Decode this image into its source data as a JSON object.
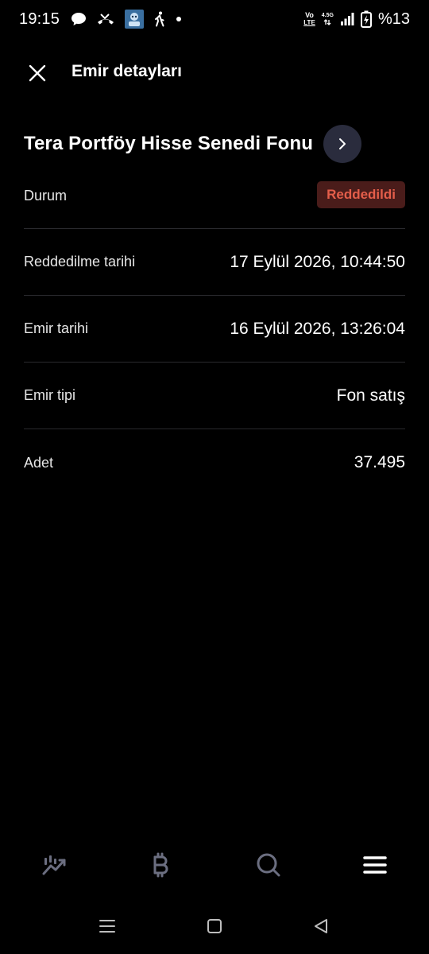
{
  "status_bar": {
    "time": "19:15",
    "left_icons": [
      "chat-bubble-icon",
      "missed-call-icon",
      "app-avatar-icon",
      "walking-icon",
      "dot-icon"
    ],
    "network_top": "Vo",
    "network_bottom": "LTE",
    "network_gen": "4.5G",
    "battery_text": "%13"
  },
  "header": {
    "title": "Emir detayları"
  },
  "fund": {
    "name": "Tera Portföy Hisse Senedi Fonu"
  },
  "details": {
    "status": {
      "label": "Durum",
      "value": "Reddedildi"
    },
    "rejected_date": {
      "label": "Reddedilme tarihi",
      "value": "17 Eylül 2026, 10:44:50"
    },
    "order_date": {
      "label": "Emir tarihi",
      "value": "16 Eylül 2026, 13:26:04"
    },
    "order_type": {
      "label": "Emir tipi",
      "value": "Fon satış"
    },
    "quantity": {
      "label": "Adet",
      "value": "37.495"
    }
  },
  "colors": {
    "background": "#000000",
    "badge_bg": "#4a1c1a",
    "badge_text": "#e45e4a",
    "chevron_bg": "#2a2c3d",
    "nav_icon": "#6b6e80",
    "nav_active": "#ffffff"
  },
  "bottom_nav": [
    "chart-icon",
    "bitcoin-icon",
    "search-icon",
    "menu-icon"
  ],
  "system_nav": [
    "recents-icon",
    "home-icon",
    "back-icon"
  ]
}
